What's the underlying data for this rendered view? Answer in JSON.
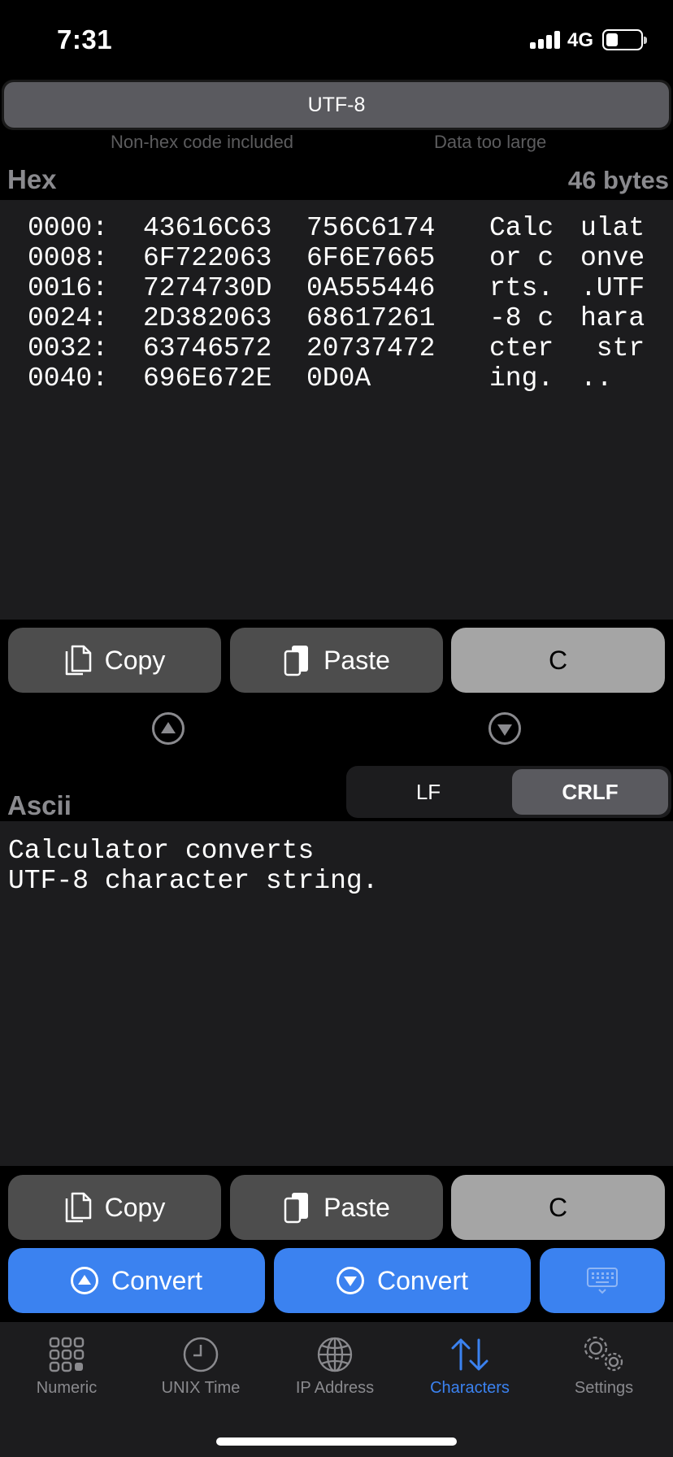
{
  "status_bar": {
    "time": "7:31",
    "network": "4G"
  },
  "encoding": {
    "label": "UTF-8"
  },
  "warnings": {
    "non_hex": "Non-hex code included",
    "too_large": "Data too large"
  },
  "hex": {
    "title": "Hex",
    "byte_count": "46 bytes",
    "rows": [
      {
        "offset": "0000:",
        "w1": "43616C63",
        "w2": "756C6174",
        "a1": "Calc",
        "a2": "ulat"
      },
      {
        "offset": "0008:",
        "w1": "6F722063",
        "w2": "6F6E7665",
        "a1": "or c",
        "a2": "onve"
      },
      {
        "offset": "0016:",
        "w1": "7274730D",
        "w2": "0A555446",
        "a1": "rts.",
        "a2": ".UTF"
      },
      {
        "offset": "0024:",
        "w1": "2D382063",
        "w2": "68617261",
        "a1": "-8 c",
        "a2": "hara"
      },
      {
        "offset": "0032:",
        "w1": "63746572",
        "w2": "20737472",
        "a1": "cter",
        "a2": " str"
      },
      {
        "offset": "0040:",
        "w1": "696E672E",
        "w2": "0D0A",
        "a1": "ing.",
        "a2": ".."
      }
    ]
  },
  "buttons": {
    "copy": "Copy",
    "paste": "Paste",
    "clear": "C",
    "convert_up": "Convert",
    "convert_down": "Convert"
  },
  "line_ending": {
    "lf": "LF",
    "crlf": "CRLF",
    "selected": "CRLF"
  },
  "ascii": {
    "title": "Ascii",
    "lines": [
      "Calculator converts",
      "UTF-8 character string."
    ]
  },
  "tabs": [
    {
      "label": "Numeric",
      "icon": "grid-icon"
    },
    {
      "label": "UNIX Time",
      "icon": "clock-icon"
    },
    {
      "label": "IP Address",
      "icon": "globe-icon"
    },
    {
      "label": "Characters",
      "icon": "arrows-updown-icon",
      "active": true
    },
    {
      "label": "Settings",
      "icon": "gears-icon"
    }
  ],
  "colors": {
    "accent": "#3b82f0",
    "panel": "#1c1c1e",
    "button_dark": "#4d4d4d",
    "button_light": "#a5a5a5"
  }
}
